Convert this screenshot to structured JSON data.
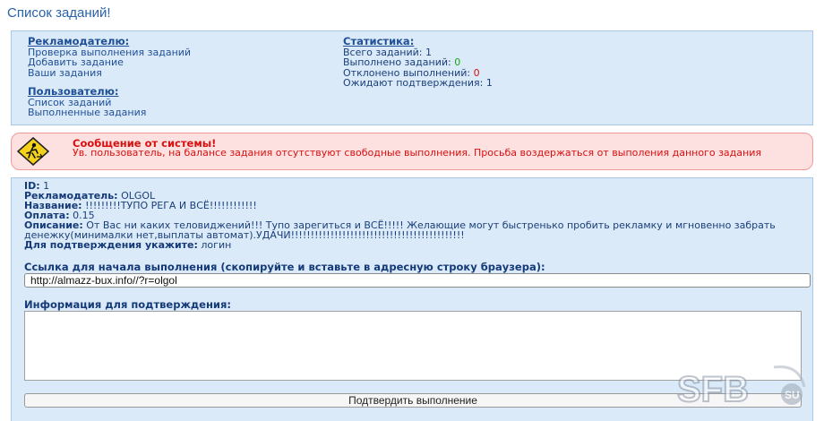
{
  "page": {
    "title": "Список заданий!"
  },
  "advertiser": {
    "header": "Рекламодателю:",
    "links": [
      "Проверка выполнения заданий",
      "Добавить задание",
      "Ваши задания"
    ]
  },
  "user": {
    "header": "Пользователю:",
    "links": [
      "Список заданий",
      "Выполненные задания"
    ]
  },
  "stats": {
    "header": "Статистика:",
    "total_label": "Всего заданий:",
    "total_value": "1",
    "done_label": "Выполнено заданий:",
    "done_value": "0",
    "rejected_label": "Отклонено выполнений:",
    "rejected_value": "0",
    "pending_label": "Ожидают подтверждения:",
    "pending_value": "1"
  },
  "message": {
    "title": "Сообщение от системы!",
    "text": "Ув. пользователь, на балансе задания отсутствуют свободные выполнения. Просьба воздержаться от выполения данного задания",
    "icon": "warning-sign-icon"
  },
  "task": {
    "id_label": "ID:",
    "id_value": "1",
    "advertiser_label": "Рекламодатель:",
    "advertiser_value": "OLGOL",
    "name_label": "Название:",
    "name_value": "!!!!!!!!!ТУПО РЕГА И ВСЁ!!!!!!!!!!!!",
    "pay_label": "Оплата:",
    "pay_value": "0.15",
    "desc_label": "Описание:",
    "desc_value": "От Вас ни каких теловиджений!!! Тупо зарегиться и ВСЁ!!!!! Желающие могут быстренько пробить рекламку и мгновенно забрать денежку(минималки нет,выплаты автомат).УДАЧИ!!!!!!!!!!!!!!!!!!!!!!!!!!!!!!!!!!!!!!!!!!!!",
    "confirm_label": "Для подтверждения укажите:",
    "confirm_value": "логин",
    "link_label": "Ссылка для начала выполнения (скопируйте и вставьте в адресную строку браузера):",
    "link_value": "http://almazz-bux.info//?r=olgol",
    "info_label": "Информация для подтверждения:",
    "submit_label": "Подтвердить выполнение"
  },
  "watermark": {
    "text": "SFB",
    "suffix": "SU"
  },
  "colors": {
    "accent": "#2a63a8",
    "panel": "#dbeaf8",
    "alert": "#d81010",
    "success": "#1aa31a"
  }
}
